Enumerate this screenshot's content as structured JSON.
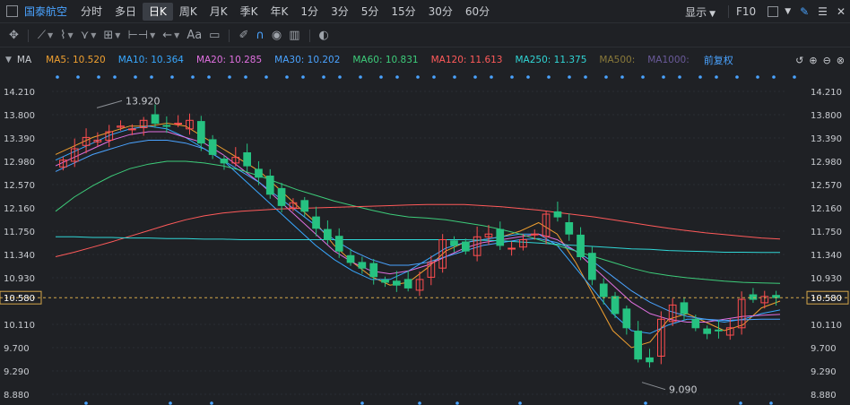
{
  "stock_name": "国泰航空",
  "periods": [
    {
      "label": "分时",
      "active": false
    },
    {
      "label": "多日",
      "active": false
    },
    {
      "label": "日K",
      "active": true
    },
    {
      "label": "周K",
      "active": false
    },
    {
      "label": "月K",
      "active": false
    },
    {
      "label": "季K",
      "active": false
    },
    {
      "label": "年K",
      "active": false
    },
    {
      "label": "1分",
      "active": false
    },
    {
      "label": "3分",
      "active": false
    },
    {
      "label": "5分",
      "active": false
    },
    {
      "label": "15分",
      "active": false
    },
    {
      "label": "30分",
      "active": false
    },
    {
      "label": "60分",
      "active": false
    }
  ],
  "topright": {
    "display_label": "显示",
    "f10_label": "F10"
  },
  "toolbar": {
    "text_tool_label": "Aa"
  },
  "ma_legend": {
    "title": "MA",
    "restore_label": "前复权",
    "items": [
      {
        "label": "MA5: 10.520",
        "color": "#f0a030"
      },
      {
        "label": "MA10: 10.364",
        "color": "#38a8ff"
      },
      {
        "label": "MA20: 10.285",
        "color": "#e070e0"
      },
      {
        "label": "MA30: 10.202",
        "color": "#4aa3ff"
      },
      {
        "label": "MA60: 10.831",
        "color": "#3dcc7a"
      },
      {
        "label": "MA120: 11.613",
        "color": "#ff5a5a"
      },
      {
        "label": "MA250: 11.375",
        "color": "#30d6d6"
      },
      {
        "label": "MA500:",
        "color": "#8a7a3a"
      },
      {
        "label": "MA1000:",
        "color": "#6a5a9a"
      }
    ]
  },
  "chart_data": {
    "type": "candlestick",
    "y_ticks": [
      "14.210",
      "13.800",
      "13.390",
      "12.980",
      "12.570",
      "12.160",
      "11.750",
      "11.340",
      "10.930",
      "10.580",
      "10.110",
      "9.700",
      "9.290",
      "8.880"
    ],
    "ylim": [
      8.88,
      14.21
    ],
    "current_price": "10.580",
    "high_label": "13.920",
    "low_label": "9.090",
    "colors": {
      "up": "#ff4d4f",
      "down": "#26c281",
      "grid": "#2a2d32",
      "current_line": "#d6a84a"
    },
    "approx_closes": [
      13.0,
      13.2,
      13.4,
      13.35,
      13.5,
      13.6,
      13.55,
      13.7,
      13.65,
      13.6,
      13.65,
      13.7,
      13.3,
      13.1,
      12.95,
      13.05,
      12.9,
      12.7,
      12.4,
      12.2,
      12.25,
      12.1,
      11.8,
      11.6,
      11.4,
      11.2,
      11.1,
      10.95,
      10.85,
      10.8,
      10.75,
      10.9,
      11.2,
      11.6,
      11.5,
      11.4,
      11.65,
      11.7,
      11.5,
      11.45,
      11.6,
      11.7,
      12.05,
      12.0,
      11.7,
      11.3,
      10.9,
      10.6,
      10.3,
      10.05,
      9.5,
      9.45,
      10.2,
      10.45,
      10.3,
      10.05,
      9.95,
      10.0,
      10.05,
      10.55,
      10.55,
      10.6,
      10.58
    ],
    "ma_series": [
      {
        "name": "MA5",
        "color": "#f0a030",
        "values": [
          13.1,
          13.25,
          13.4,
          13.5,
          13.6,
          13.6,
          13.65,
          13.6,
          13.4,
          13.2,
          13.0,
          12.8,
          12.5,
          12.2,
          11.9,
          11.5,
          11.2,
          10.95,
          10.8,
          10.85,
          11.1,
          11.4,
          11.55,
          11.6,
          11.65,
          11.75,
          11.9,
          11.7,
          11.2,
          10.6,
          10.0,
          9.7,
          9.8,
          10.2,
          10.3,
          10.15,
          10.0,
          10.1,
          10.4,
          10.52
        ]
      },
      {
        "name": "MA10",
        "color": "#38a8ff",
        "values": [
          13.0,
          13.15,
          13.3,
          13.45,
          13.55,
          13.6,
          13.55,
          13.4,
          13.2,
          13.0,
          12.7,
          12.4,
          12.1,
          11.8,
          11.5,
          11.25,
          11.05,
          10.9,
          10.9,
          11.05,
          11.25,
          11.45,
          11.55,
          11.6,
          11.65,
          11.7,
          11.7,
          11.5,
          11.1,
          10.7,
          10.3,
          10.0,
          9.95,
          10.1,
          10.2,
          10.2,
          10.15,
          10.2,
          10.3,
          10.364
        ]
      },
      {
        "name": "MA20",
        "color": "#e070e0",
        "values": [
          12.9,
          13.05,
          13.2,
          13.35,
          13.45,
          13.5,
          13.5,
          13.4,
          13.3,
          13.1,
          12.85,
          12.6,
          12.3,
          12.0,
          11.7,
          11.4,
          11.2,
          11.05,
          11.0,
          11.05,
          11.15,
          11.3,
          11.45,
          11.55,
          11.6,
          11.65,
          11.7,
          11.6,
          11.4,
          11.1,
          10.8,
          10.5,
          10.3,
          10.2,
          10.15,
          10.15,
          10.2,
          10.25,
          10.27,
          10.285
        ]
      },
      {
        "name": "MA30",
        "color": "#4aa3ff",
        "values": [
          12.8,
          12.95,
          13.1,
          13.2,
          13.3,
          13.35,
          13.35,
          13.3,
          13.2,
          13.0,
          12.8,
          12.6,
          12.35,
          12.1,
          11.85,
          11.6,
          11.4,
          11.25,
          11.15,
          11.15,
          11.2,
          11.3,
          11.4,
          11.5,
          11.55,
          11.6,
          11.62,
          11.55,
          11.4,
          11.2,
          10.95,
          10.7,
          10.5,
          10.35,
          10.25,
          10.2,
          10.18,
          10.19,
          10.2,
          10.202
        ]
      },
      {
        "name": "MA60",
        "color": "#3dcc7a",
        "values": [
          12.1,
          12.35,
          12.55,
          12.72,
          12.85,
          12.93,
          12.98,
          12.98,
          12.95,
          12.9,
          12.82,
          12.72,
          12.6,
          12.48,
          12.38,
          12.28,
          12.2,
          12.12,
          12.05,
          12.0,
          11.98,
          11.95,
          11.9,
          11.85,
          11.78,
          11.7,
          11.6,
          11.5,
          11.4,
          11.3,
          11.2,
          11.1,
          11.02,
          10.97,
          10.93,
          10.9,
          10.87,
          10.85,
          10.84,
          10.831
        ]
      },
      {
        "name": "MA120",
        "color": "#ff5a5a",
        "values": [
          11.3,
          11.38,
          11.47,
          11.56,
          11.66,
          11.76,
          11.86,
          11.95,
          12.02,
          12.07,
          12.1,
          12.12,
          12.14,
          12.15,
          12.16,
          12.17,
          12.18,
          12.19,
          12.2,
          12.21,
          12.22,
          12.22,
          12.22,
          12.2,
          12.18,
          12.15,
          12.12,
          12.08,
          12.04,
          12.0,
          11.95,
          11.9,
          11.85,
          11.8,
          11.76,
          11.72,
          11.69,
          11.66,
          11.63,
          11.613
        ]
      },
      {
        "name": "MA250",
        "color": "#30d6d6",
        "values": [
          11.65,
          11.65,
          11.64,
          11.64,
          11.63,
          11.63,
          11.62,
          11.62,
          11.61,
          11.61,
          11.6,
          11.6,
          11.6,
          11.6,
          11.6,
          11.6,
          11.6,
          11.6,
          11.6,
          11.6,
          11.6,
          11.6,
          11.6,
          11.59,
          11.58,
          11.56,
          11.54,
          11.52,
          11.5,
          11.48,
          11.46,
          11.44,
          11.43,
          11.41,
          11.4,
          11.39,
          11.38,
          11.38,
          11.375,
          11.375
        ]
      }
    ]
  }
}
